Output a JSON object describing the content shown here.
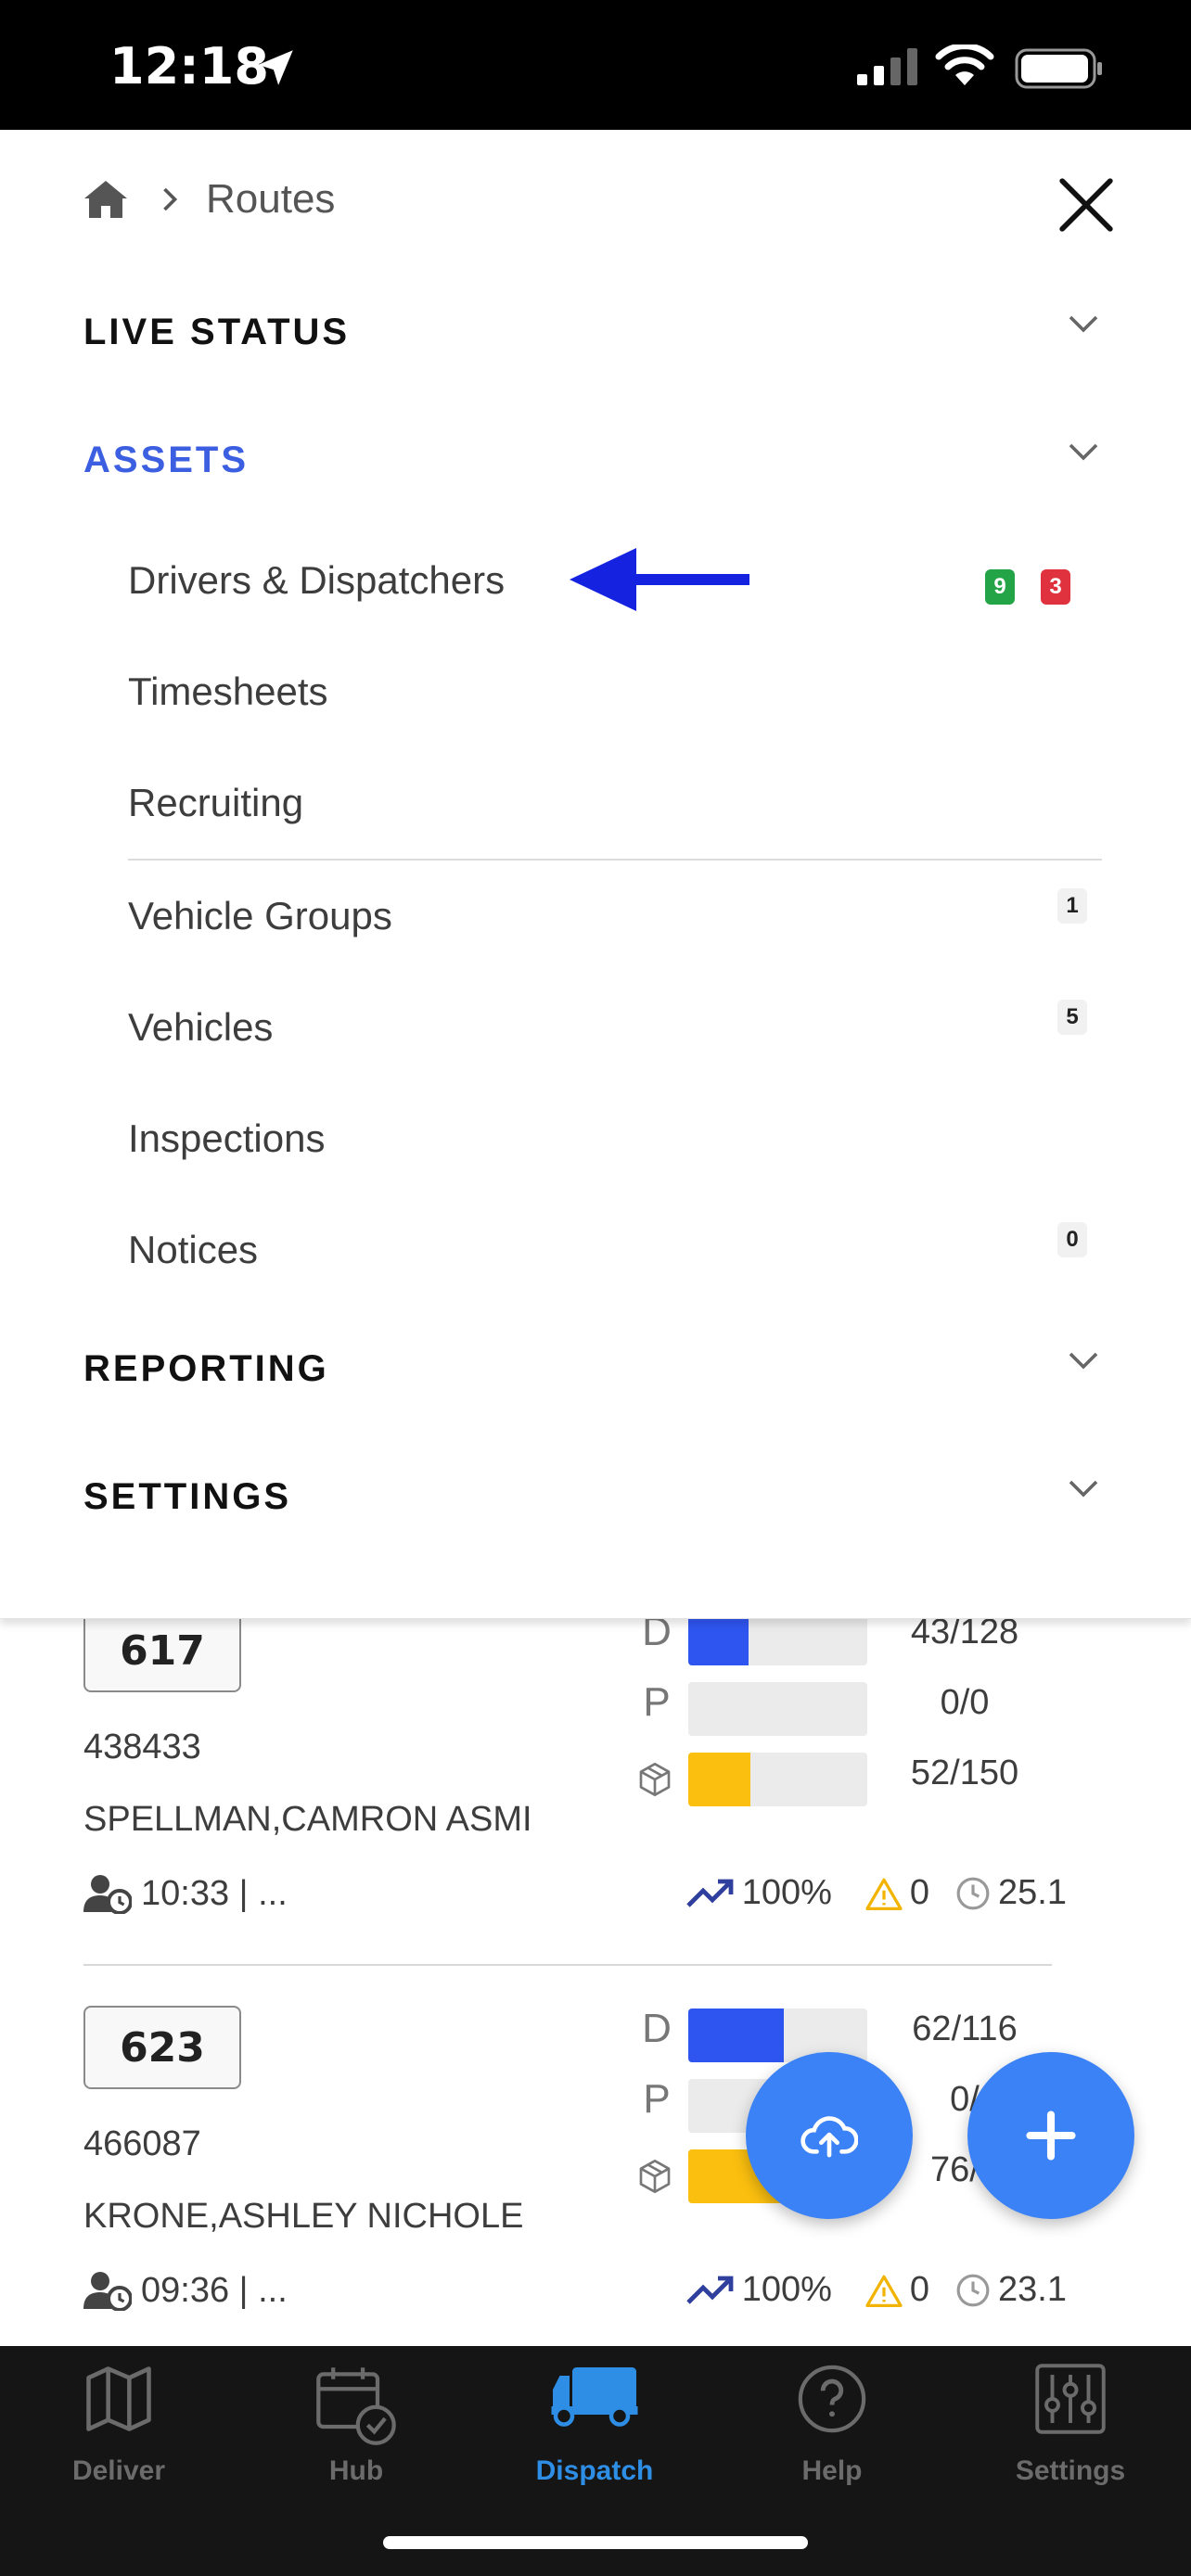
{
  "status_bar": {
    "time": "12:18"
  },
  "menu": {
    "breadcrumb": {
      "current": "Routes"
    },
    "sections": {
      "live_status": "LIVE STATUS",
      "assets": "ASSETS",
      "reporting": "REPORTING",
      "settings": "SETTINGS"
    },
    "asset_items": [
      {
        "label": "Drivers & Dispatchers",
        "badge_green": "9",
        "badge_red": "3"
      },
      {
        "label": "Timesheets"
      },
      {
        "label": "Recruiting"
      },
      {
        "label": "Vehicle Groups",
        "badge": "1"
      },
      {
        "label": "Vehicles",
        "badge": "5"
      },
      {
        "label": "Inspections"
      },
      {
        "label": "Notices",
        "badge": "0"
      }
    ]
  },
  "routes": [
    {
      "number": "617",
      "id": "438433",
      "driver": "SPELLMAN,CAMRON ASMI",
      "d_label": "D",
      "d_value": "43/128",
      "d_fill": 0.336,
      "p_label": "P",
      "p_value": "0/0",
      "p_fill": 0,
      "pkg_value": "52/150",
      "pkg_fill": 0.347,
      "time": "10:33 | ...",
      "pct": "100%",
      "warnings": "0",
      "hours": "25.1"
    },
    {
      "number": "623",
      "id": "466087",
      "driver": "KRONE,ASHLEY NICHOLE",
      "d_label": "D",
      "d_value": "62/116",
      "d_fill": 0.534,
      "p_label": "P",
      "p_value": "0/",
      "p_fill": 0,
      "pkg_value": "76/1",
      "pkg_fill": 0.6,
      "time": "09:36 | ...",
      "pct": "100%",
      "warnings": "0",
      "hours": "23.1"
    }
  ],
  "tabs": [
    {
      "label": "Deliver"
    },
    {
      "label": "Hub"
    },
    {
      "label": "Dispatch"
    },
    {
      "label": "Help"
    },
    {
      "label": "Settings"
    }
  ],
  "colors": {
    "accent": "#3b5fe0",
    "fab": "#3b82f6",
    "bar_blue": "#2f55f0",
    "bar_yellow": "#fbbf0f",
    "badge_green": "#22a447",
    "badge_red": "#e0323e",
    "tab_active": "#2e8ee6"
  }
}
